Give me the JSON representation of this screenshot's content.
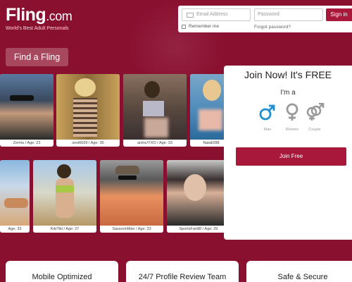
{
  "logo": {
    "name": "Fling",
    "dotcom": ".com",
    "tagline": "World's Best Adult Personals"
  },
  "login": {
    "email_placeholder": "Email Address",
    "password_placeholder": "Password",
    "sign_in_label": "Sign in",
    "remember_label": "Remember me",
    "forgot_label": "Forgot password?"
  },
  "find_button": "Find a Fling",
  "profiles_row1": [
    {
      "caption": "Zerms / Age: 23"
    },
    {
      "caption": "sexi6639 / Age: 35"
    },
    {
      "caption": "antnc/YXO / Age: 33"
    },
    {
      "caption": "Natali288"
    }
  ],
  "profiles_row2": [
    {
      "caption": "Age: 33"
    },
    {
      "caption": "KikiTiki / Age: 27"
    },
    {
      "caption": "SassoonMan / Age: 33"
    },
    {
      "caption": "SportsFan88 / Age: 29"
    }
  ],
  "join": {
    "title": "Join Now! It's FREE",
    "iam": "I'm a",
    "options": [
      "Man",
      "Women",
      "Couple"
    ],
    "button": "Join Free"
  },
  "features": [
    "Mobile Optimized",
    "24/7 Profile Review Team",
    "Safe & Secure"
  ],
  "colors": {
    "brand": "#8a1030",
    "accent": "#a8183a",
    "man_icon": "#1e8fd0",
    "gray_icon": "#999999"
  }
}
